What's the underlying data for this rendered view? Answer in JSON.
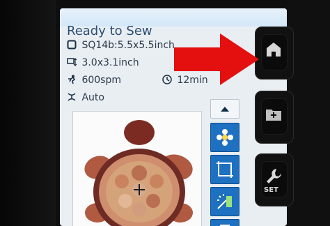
{
  "screen": {
    "title": "Ready to Sew",
    "hoop": "SQ14b:5.5x5.5inch",
    "size": "3.0x3.1inch",
    "speed": "600spm",
    "time": "12min",
    "color_mode": "Auto"
  },
  "icons": {
    "hoop": "hoop-icon",
    "size": "size-icon",
    "thread": "thread-spool-icon",
    "speed": "speed-runner-icon",
    "time": "clock-icon",
    "auto": "auto-color-icon",
    "arrow_up": "arrow-up-icon",
    "design_tools": [
      "flower-icon",
      "frame-resize-icon",
      "wand-color-icon",
      "hoop-move-icon"
    ],
    "hardware": [
      "home-icon",
      "folder-icon",
      "wrench-icon"
    ]
  },
  "hardware_buttons": {
    "set_label": "SET"
  },
  "colors": {
    "screen_bg": "#e9eef2",
    "header_blue": "#d3e7f7",
    "tool_blue": "#1e70c1",
    "arrow_red": "#e41010",
    "turtle_dark": "#7c2b23",
    "turtle_mid": "#b05a41",
    "turtle_light": "#d5a37a"
  }
}
